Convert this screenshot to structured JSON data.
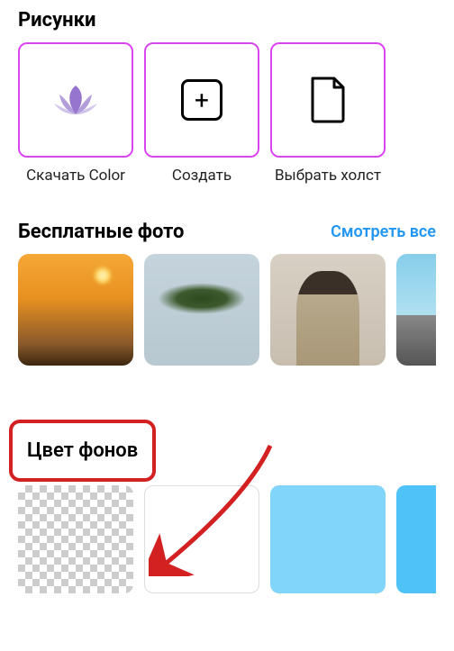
{
  "sections": {
    "drawings": {
      "title": "Рисунки",
      "tiles": [
        {
          "label": "Скачать Color",
          "icon": "lotus"
        },
        {
          "label": "Создать",
          "icon": "plus"
        },
        {
          "label": "Выбрать холст",
          "icon": "document"
        }
      ]
    },
    "free_photos": {
      "title": "Бесплатные фото",
      "see_all": "Смотреть все"
    },
    "bg_colors": {
      "title": "Цвет фонов",
      "swatches": [
        {
          "name": "transparent",
          "color": "transparent"
        },
        {
          "name": "white",
          "color": "#ffffff"
        },
        {
          "name": "light-blue",
          "color": "#81d4fa"
        },
        {
          "name": "sky-blue",
          "color": "#4fc3f7"
        }
      ]
    }
  },
  "annotation": {
    "arrow_color": "#d32020"
  }
}
